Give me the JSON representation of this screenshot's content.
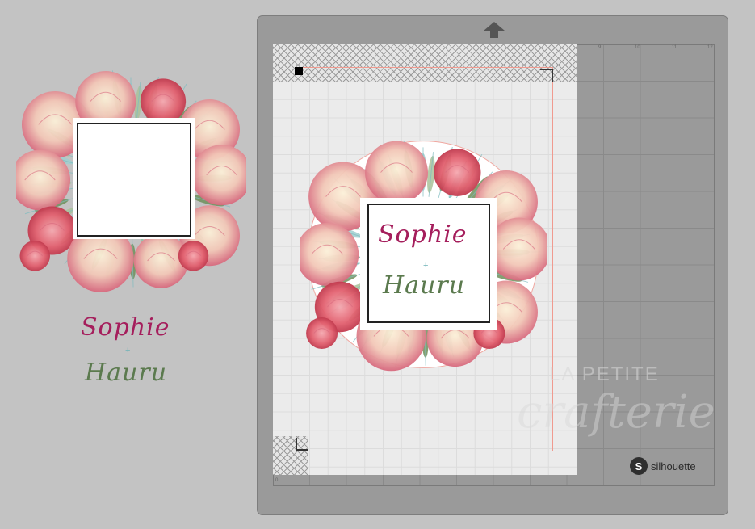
{
  "preview": {
    "name_line1": "Sophie",
    "plus_symbol": "+",
    "name_line2": "Hauru"
  },
  "mat": {
    "brand": "silhouette",
    "brand_logo_letter": "S",
    "watermark_line1": "LA PETITE",
    "watermark_line2": "crafterie",
    "ruler_top": [
      "9",
      "10",
      "11",
      "12"
    ],
    "ruler_bottom": [
      "0"
    ]
  },
  "design": {
    "name_line1": "Sophie",
    "plus_symbol": "+",
    "name_line2": "Hauru"
  },
  "colors": {
    "name1": "#a51e5c",
    "name2": "#5b7a4e",
    "accent": "#6fb3b7",
    "cut_line": "#f09a8f"
  }
}
